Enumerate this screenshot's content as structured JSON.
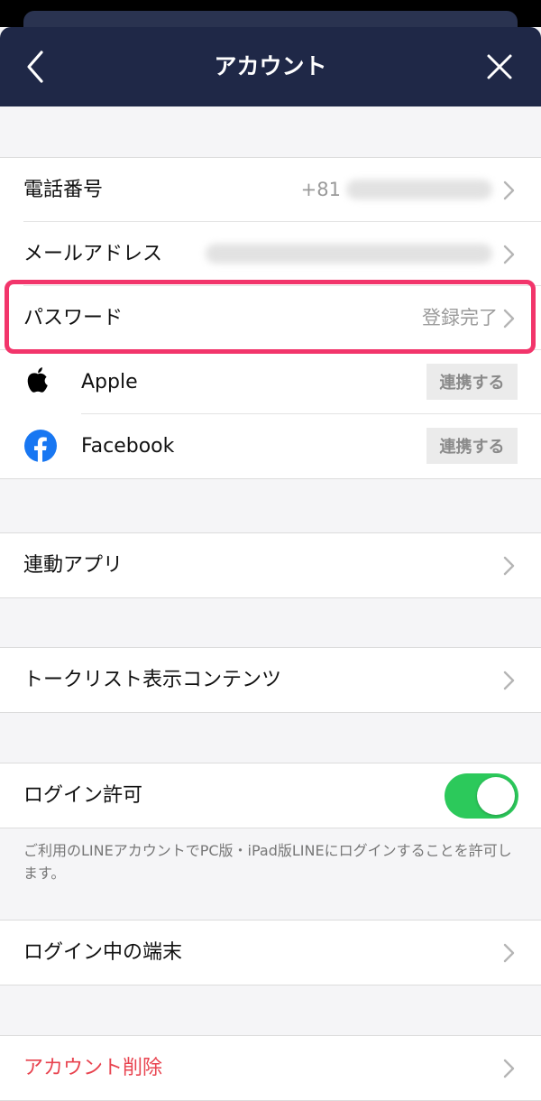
{
  "header": {
    "title": "アカウント"
  },
  "account": {
    "phone_label": "電話番号",
    "phone_value": "+81",
    "email_label": "メールアドレス",
    "password_label": "パスワード",
    "password_status": "登録完了"
  },
  "social": [
    {
      "name": "Apple",
      "button": "連携する"
    },
    {
      "name": "Facebook",
      "button": "連携する"
    }
  ],
  "menu": {
    "linked_apps": "連動アプリ",
    "talk_list": "トークリスト表示コンテンツ",
    "login_permission": "ログイン許可",
    "login_permission_note": "ご利用のLINEアカウントでPC版・iPad版LINEにログインすることを許可します。",
    "login_devices": "ログイン中の端末",
    "delete_account": "アカウント削除"
  },
  "toggle": {
    "login_permission_on": true
  },
  "colors": {
    "header_bg": "#1f2847",
    "highlight": "#f2356b",
    "toggle_on": "#2cc95b",
    "danger": "#e8434f",
    "facebook": "#1877f2"
  }
}
